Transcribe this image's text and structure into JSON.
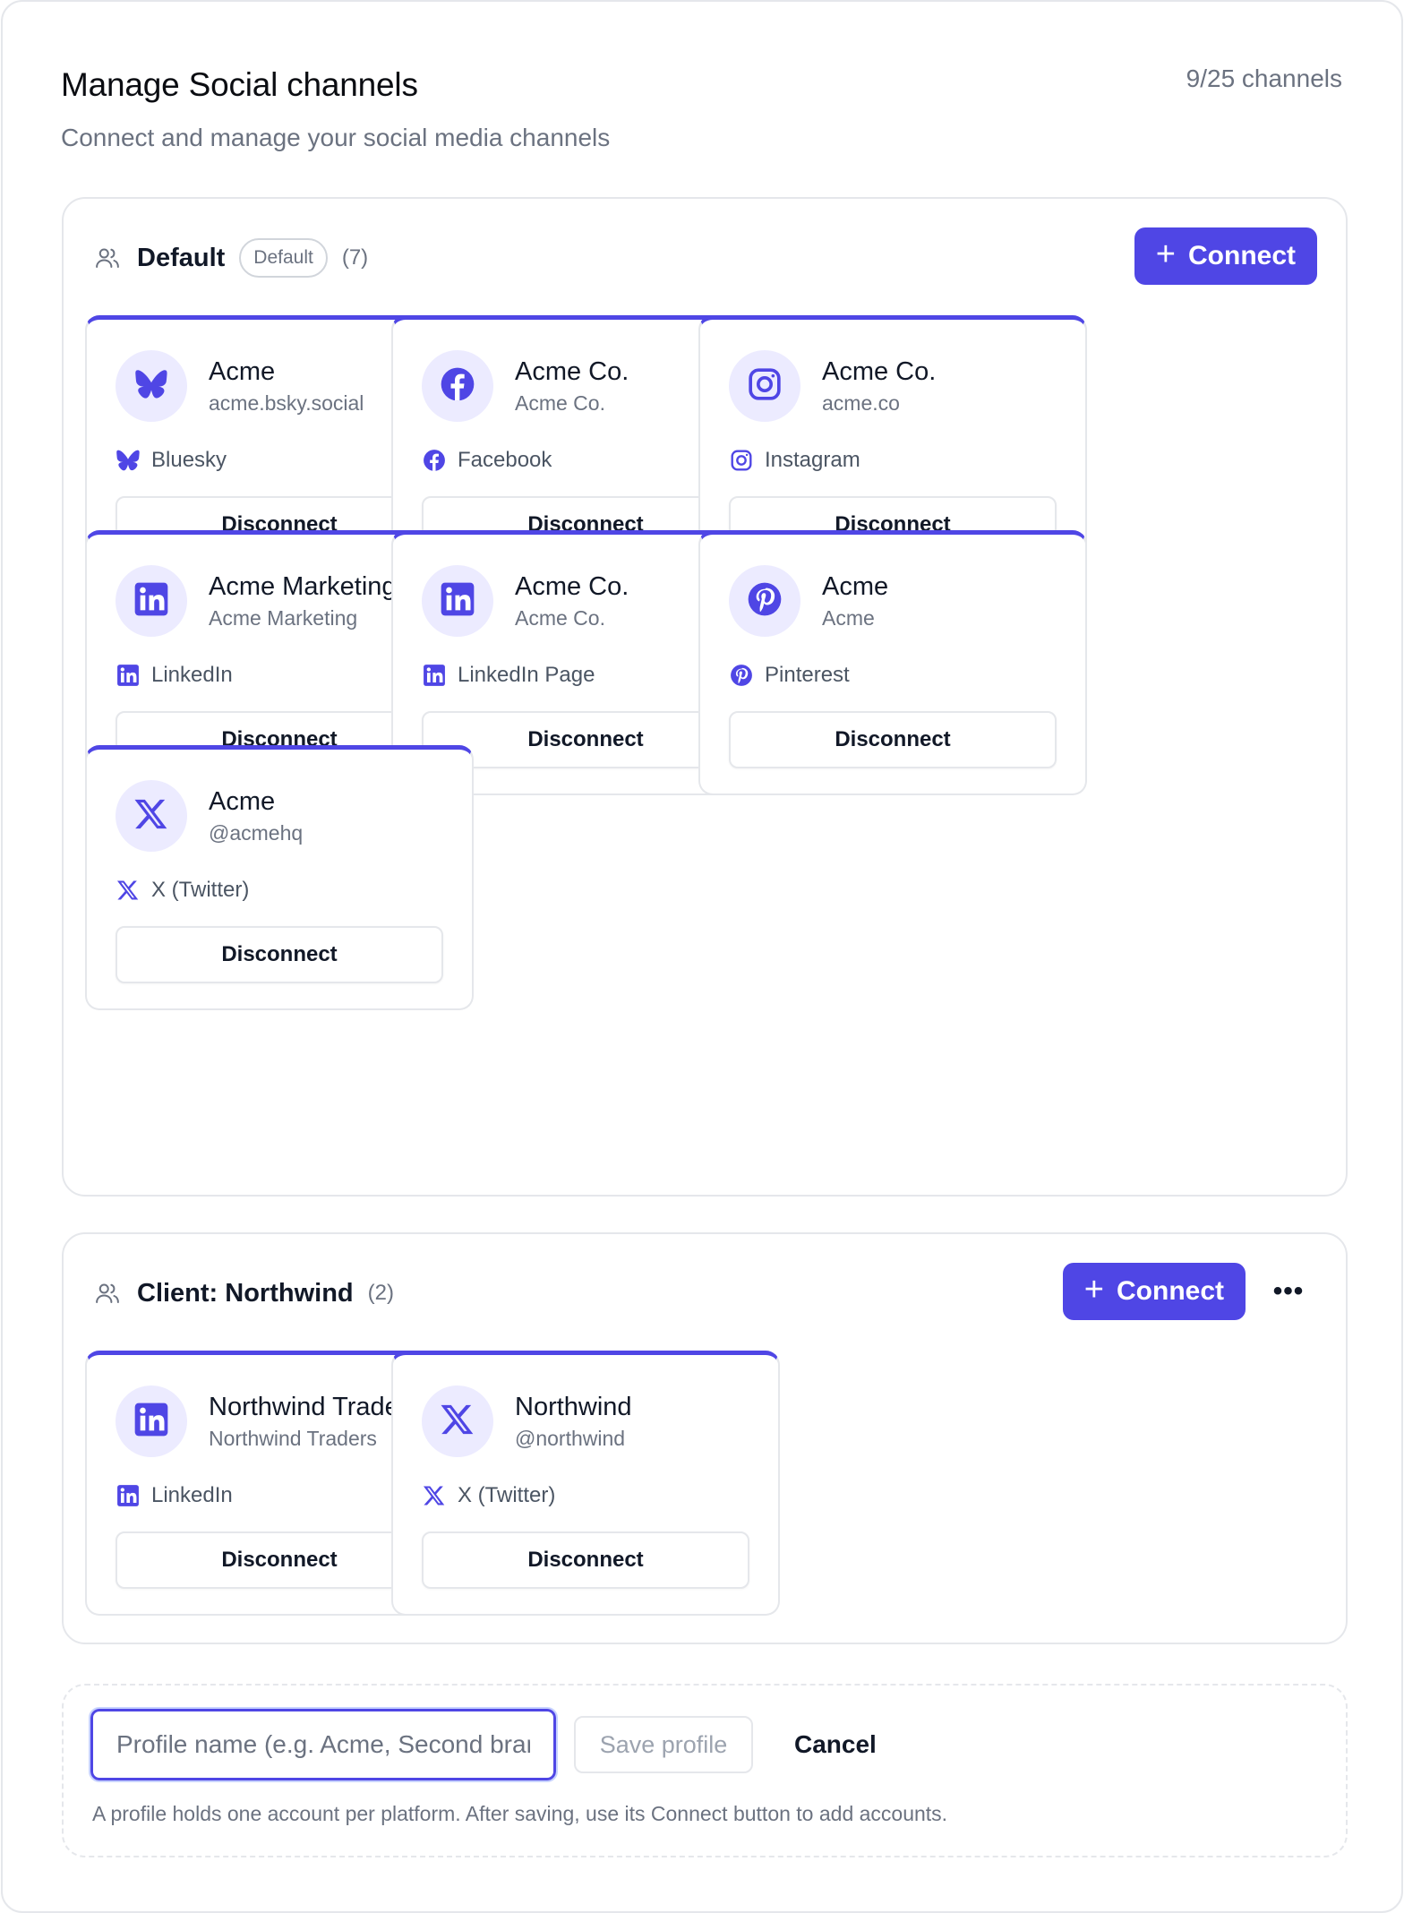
{
  "header": {
    "title": "Manage Social channels",
    "subtitle": "Connect and manage your social media channels",
    "channel_count": "9/25 channels"
  },
  "accent_color": "#4f46e5",
  "groups": [
    {
      "name": "Default",
      "badge": "Default",
      "count": "(7)",
      "connect_label": "Connect",
      "accounts": [
        {
          "name": "Acme",
          "handle": "acme.bsky.social",
          "platform": "Bluesky",
          "icon": "bluesky-icon",
          "action": "Disconnect"
        },
        {
          "name": "Acme Co.",
          "handle": "Acme Co.",
          "platform": "Facebook",
          "icon": "facebook-icon",
          "action": "Disconnect"
        },
        {
          "name": "Acme Co.",
          "handle": "acme.co",
          "platform": "Instagram",
          "icon": "instagram-icon",
          "action": "Disconnect"
        },
        {
          "name": "Acme Marketing",
          "handle": "Acme Marketing",
          "platform": "LinkedIn",
          "icon": "linkedin-icon",
          "action": "Disconnect"
        },
        {
          "name": "Acme Co.",
          "handle": "Acme Co.",
          "platform": "LinkedIn Page",
          "icon": "linkedin-icon",
          "action": "Disconnect"
        },
        {
          "name": "Acme",
          "handle": "Acme",
          "platform": "Pinterest",
          "icon": "pinterest-icon",
          "action": "Disconnect"
        },
        {
          "name": "Acme",
          "handle": "@acmehq",
          "platform": "X (Twitter)",
          "icon": "x-icon",
          "action": "Disconnect"
        }
      ]
    },
    {
      "name": "Client: Northwind",
      "count": "(2)",
      "connect_label": "Connect",
      "more_label": "•••",
      "accounts": [
        {
          "name": "Northwind Traders",
          "handle": "Northwind Traders",
          "platform": "LinkedIn",
          "icon": "linkedin-icon",
          "action": "Disconnect"
        },
        {
          "name": "Northwind",
          "handle": "@northwind",
          "platform": "X (Twitter)",
          "icon": "x-icon",
          "action": "Disconnect"
        }
      ]
    }
  ],
  "profile_form": {
    "input_placeholder": "Profile name (e.g. Acme, Second brand)",
    "input_value": "",
    "save_label": "Save profile",
    "cancel_label": "Cancel",
    "helper_text": "A profile holds one account per platform. After saving, use its Connect button to add accounts."
  }
}
